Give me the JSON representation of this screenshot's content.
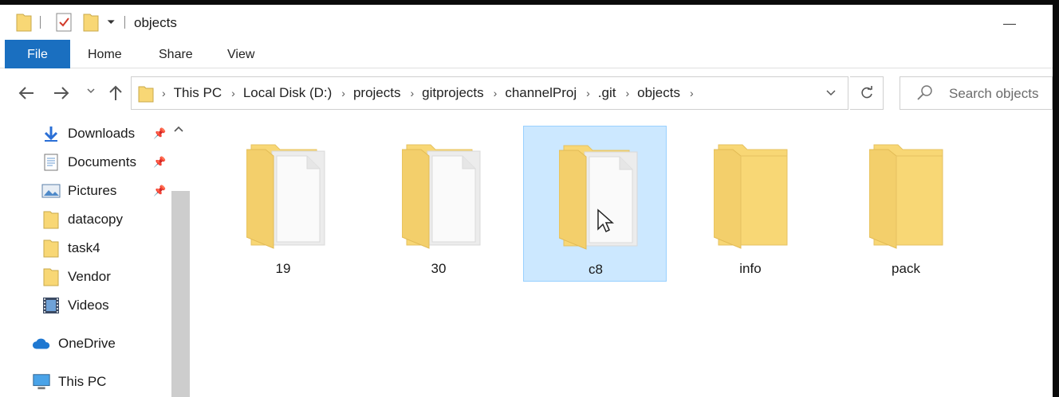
{
  "window": {
    "title": "objects"
  },
  "ribbon": {
    "tabs": [
      {
        "label": "File"
      },
      {
        "label": "Home"
      },
      {
        "label": "Share"
      },
      {
        "label": "View"
      }
    ]
  },
  "address_bar": {
    "crumbs": [
      "This PC",
      "Local Disk (D:)",
      "projects",
      "gitprojects",
      "channelProj",
      ".git",
      "objects"
    ]
  },
  "search": {
    "placeholder": "Search objects"
  },
  "sidebar": {
    "items": [
      {
        "label": "Downloads",
        "icon": "download-arrow-icon",
        "pinned": true
      },
      {
        "label": "Documents",
        "icon": "documents-icon",
        "pinned": true
      },
      {
        "label": "Pictures",
        "icon": "pictures-icon",
        "pinned": true
      },
      {
        "label": "datacopy",
        "icon": "folder-icon",
        "pinned": false
      },
      {
        "label": "task4",
        "icon": "folder-icon",
        "pinned": false
      },
      {
        "label": "Vendor",
        "icon": "folder-icon",
        "pinned": false
      },
      {
        "label": "Videos",
        "icon": "videos-icon",
        "pinned": false
      },
      {
        "label": "OneDrive",
        "icon": "cloud-icon",
        "pinned": false
      },
      {
        "label": "This PC",
        "icon": "computer-icon",
        "pinned": false
      }
    ]
  },
  "files": [
    {
      "name": "19",
      "type": "folder-with-files",
      "selected": false
    },
    {
      "name": "30",
      "type": "folder-with-files",
      "selected": false
    },
    {
      "name": "c8",
      "type": "folder-with-files",
      "selected": true
    },
    {
      "name": "info",
      "type": "empty-folder",
      "selected": false
    },
    {
      "name": "pack",
      "type": "empty-folder",
      "selected": false
    }
  ],
  "colors": {
    "accent": "#1a6fc0",
    "selection_bg": "#cce8ff",
    "selection_border": "#99d1ff",
    "folder": "#f8d775"
  }
}
